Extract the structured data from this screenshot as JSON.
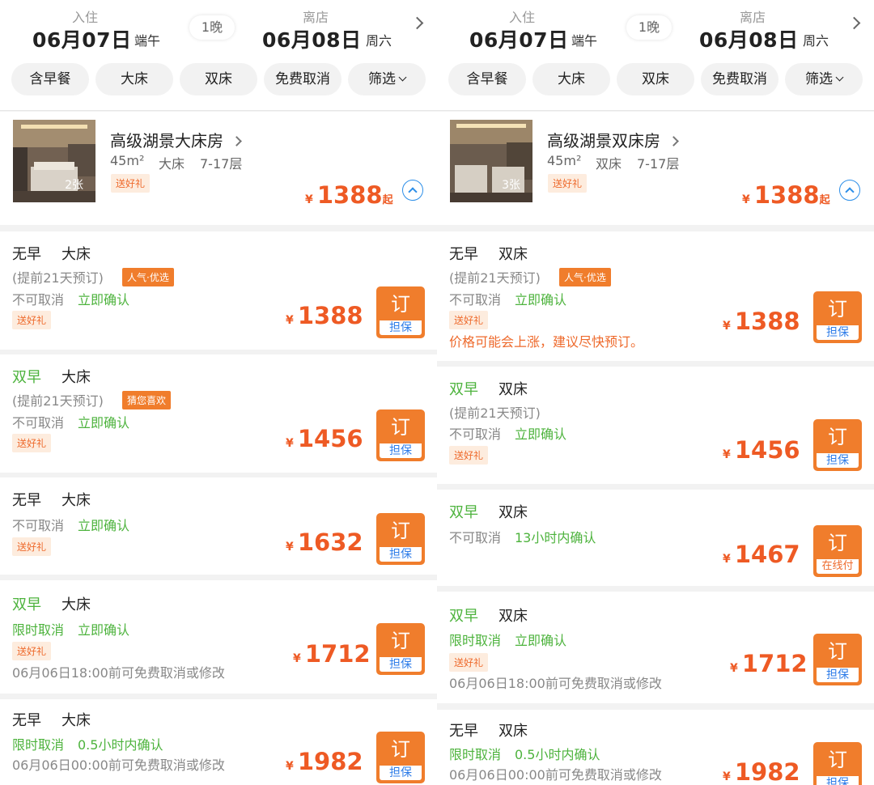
{
  "colors": {
    "accent": "#ee5a24",
    "book": "#f07d2c",
    "green": "#4db33d",
    "blue": "#2c7be8"
  },
  "icons": [
    "chevron-right-icon",
    "chevron-down-icon",
    "chevron-up-circle-icon",
    "room-photo"
  ],
  "panels": [
    {
      "header": {
        "checkin_label": "入住",
        "checkin_date": "06月07日",
        "checkin_weekday": "端午",
        "nights": "1晚",
        "checkout_label": "离店",
        "checkout_date": "06月08日",
        "checkout_weekday": "周六"
      },
      "filters": [
        "含早餐",
        "大床",
        "双床",
        "免费取消",
        "筛选"
      ],
      "room": {
        "name": "高级湖景大床房",
        "area": "45m²",
        "bed": "大床",
        "floors": "7-17层",
        "gift": "送好礼",
        "photo_count": "2张",
        "currency": "¥",
        "price": "1388",
        "price_suffix": "起"
      },
      "rates": [
        {
          "breakfast": "无早",
          "bed": "大床",
          "advance": "(提前21天预订)",
          "tag": "人气·优选",
          "cancel": "不可取消",
          "confirm": "立即确认",
          "gift": "送好礼",
          "currency": "¥",
          "price": "1388",
          "book": "订",
          "pay": "担保"
        },
        {
          "breakfast": "双早",
          "bed": "大床",
          "advance": "(提前21天预订)",
          "tag": "猜您喜欢",
          "cancel": "不可取消",
          "confirm": "立即确认",
          "gift": "送好礼",
          "currency": "¥",
          "price": "1456",
          "book": "订",
          "pay": "担保"
        },
        {
          "breakfast": "无早",
          "bed": "大床",
          "cancel": "不可取消",
          "confirm": "立即确认",
          "gift": "送好礼",
          "currency": "¥",
          "price": "1632",
          "book": "订",
          "pay": "担保"
        },
        {
          "breakfast": "双早",
          "bed": "大床",
          "cancel": "限时取消",
          "confirm": "立即确认",
          "gift": "送好礼",
          "note": "06月06日18:00前可免费取消或修改",
          "currency": "¥",
          "price": "1712",
          "book": "订",
          "pay": "担保"
        },
        {
          "breakfast": "无早",
          "bed": "大床",
          "cancel": "限时取消",
          "confirm": "0.5小时内确认",
          "note": "06月06日00:00前可免费取消或修改",
          "currency": "¥",
          "price": "1982",
          "book": "订",
          "pay": "担保"
        }
      ]
    },
    {
      "header": {
        "checkin_label": "入住",
        "checkin_date": "06月07日",
        "checkin_weekday": "端午",
        "nights": "1晚",
        "checkout_label": "离店",
        "checkout_date": "06月08日",
        "checkout_weekday": "周六"
      },
      "filters": [
        "含早餐",
        "大床",
        "双床",
        "免费取消",
        "筛选"
      ],
      "room": {
        "name": "高级湖景双床房",
        "area": "45m²",
        "bed": "双床",
        "floors": "7-17层",
        "gift": "送好礼",
        "photo_count": "3张",
        "currency": "¥",
        "price": "1388",
        "price_suffix": "起"
      },
      "rates": [
        {
          "breakfast": "无早",
          "bed": "双床",
          "advance": "(提前21天预订)",
          "tag": "人气·优选",
          "cancel": "不可取消",
          "confirm": "立即确认",
          "gift": "送好礼",
          "warning": "价格可能会上涨，建议尽快预订。",
          "currency": "¥",
          "price": "1388",
          "book": "订",
          "pay": "担保"
        },
        {
          "breakfast": "双早",
          "bed": "双床",
          "advance": "(提前21天预订)",
          "cancel": "不可取消",
          "confirm": "立即确认",
          "gift": "送好礼",
          "currency": "¥",
          "price": "1456",
          "book": "订",
          "pay": "担保"
        },
        {
          "breakfast": "双早",
          "bed": "双床",
          "cancel": "不可取消",
          "confirm": "13小时内确认",
          "currency": "¥",
          "price": "1467",
          "book": "订",
          "pay": "在线付"
        },
        {
          "breakfast": "双早",
          "bed": "双床",
          "cancel": "限时取消",
          "confirm": "立即确认",
          "gift": "送好礼",
          "note": "06月06日18:00前可免费取消或修改",
          "currency": "¥",
          "price": "1712",
          "book": "订",
          "pay": "担保"
        },
        {
          "breakfast": "无早",
          "bed": "双床",
          "cancel": "限时取消",
          "confirm": "0.5小时内确认",
          "note": "06月06日00:00前可免费取消或修改",
          "currency": "¥",
          "price": "1982",
          "book": "订",
          "pay": "担保"
        }
      ]
    }
  ]
}
